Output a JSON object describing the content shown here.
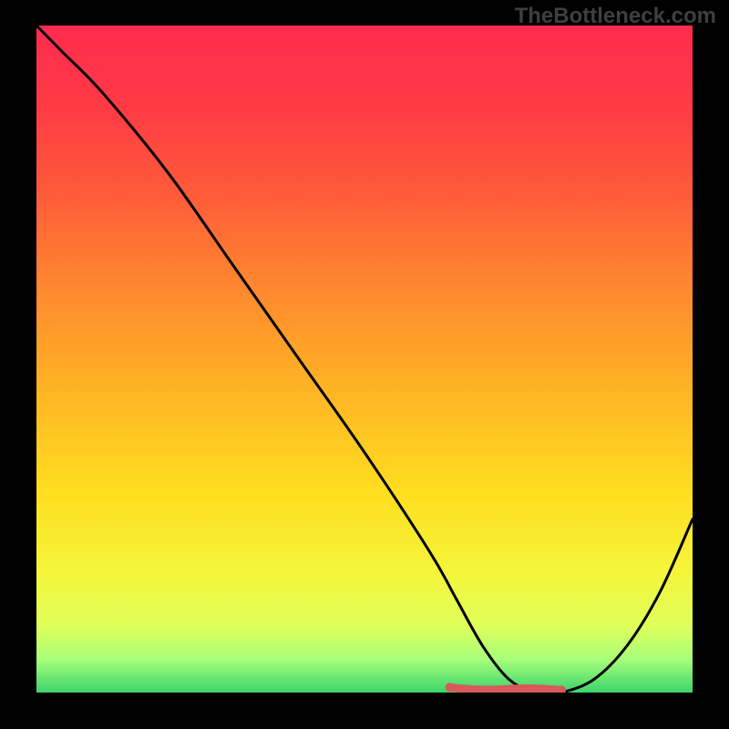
{
  "watermark": "TheBottleneck.com",
  "chart_data": {
    "type": "line",
    "title": "",
    "xlabel": "",
    "ylabel": "",
    "xlim": [
      0,
      100
    ],
    "ylim": [
      0,
      100
    ],
    "series": [
      {
        "name": "curve",
        "x": [
          0,
          4,
          10,
          20,
          30,
          40,
          50,
          60,
          64,
          68,
          72,
          76,
          80,
          85,
          90,
          95,
          100
        ],
        "y": [
          100,
          96,
          90,
          78,
          64,
          50,
          36,
          21,
          14,
          7,
          2,
          0,
          0,
          2,
          7,
          15,
          26
        ]
      }
    ],
    "flat_region": {
      "x_start": 63,
      "x_end": 80,
      "y": 0.5
    },
    "background_gradient": {
      "stops": [
        {
          "offset": 0.0,
          "color": "#ff2b4f"
        },
        {
          "offset": 0.12,
          "color": "#ff3a45"
        },
        {
          "offset": 0.25,
          "color": "#ff5a3a"
        },
        {
          "offset": 0.4,
          "color": "#ff8a2e"
        },
        {
          "offset": 0.55,
          "color": "#ffb524"
        },
        {
          "offset": 0.7,
          "color": "#ffde1f"
        },
        {
          "offset": 0.82,
          "color": "#f5f53a"
        },
        {
          "offset": 0.9,
          "color": "#dfff5a"
        },
        {
          "offset": 0.95,
          "color": "#a8ff7a"
        },
        {
          "offset": 1.0,
          "color": "#3bd46c"
        }
      ]
    },
    "curve_color": "#000000",
    "flat_marker_color": "#d65a5a"
  }
}
